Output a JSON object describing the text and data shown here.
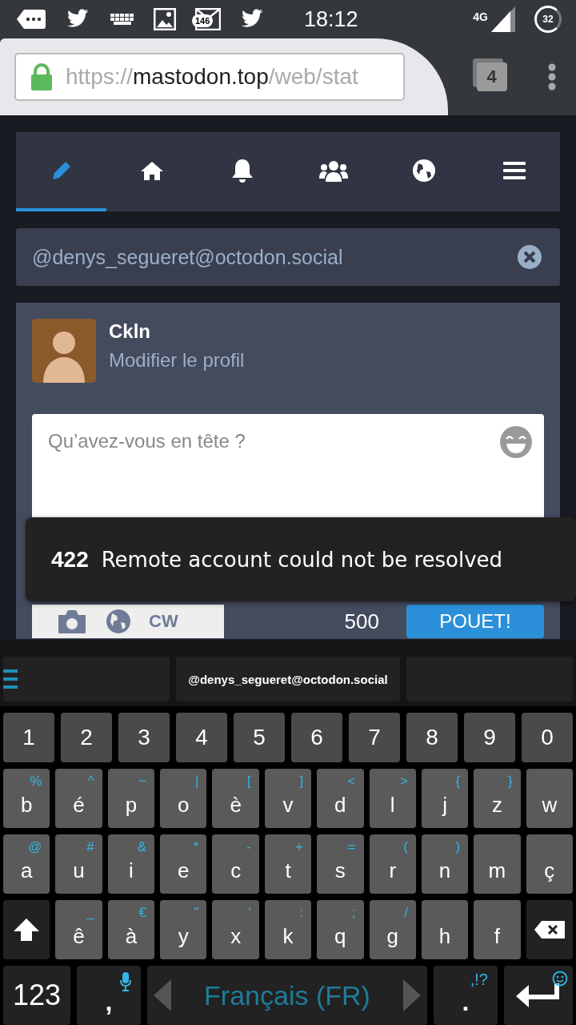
{
  "status_bar": {
    "notification_badge": "146",
    "time": "18:12",
    "network": "4G",
    "battery": "32"
  },
  "browser": {
    "url_scheme": "https://",
    "url_host": "mastodon.top",
    "url_path": "/web/stat",
    "tab_count": "4"
  },
  "nav_tabs": [
    {
      "kind": "compose",
      "selected": true
    },
    {
      "kind": "home",
      "selected": false
    },
    {
      "kind": "notifications",
      "selected": false
    },
    {
      "kind": "community",
      "selected": false
    },
    {
      "kind": "public",
      "selected": false
    },
    {
      "kind": "menu",
      "selected": false
    }
  ],
  "search": {
    "value": "@denys_segueret@octodon.social"
  },
  "profile": {
    "name": "Ckln",
    "edit_link": "Modifier le profil"
  },
  "compose": {
    "placeholder": "Qu’avez-vous en tête ?",
    "cw": "CW",
    "counter": "500",
    "submit": "POUET!"
  },
  "toast": {
    "code": "422",
    "message": "Remote account could not be resolved"
  },
  "keyboard": {
    "suggestion": "@denys_segueret@octodon.social",
    "number_row": [
      "1",
      "2",
      "3",
      "4",
      "5",
      "6",
      "7",
      "8",
      "9",
      "0"
    ],
    "letter_rows": [
      [
        {
          "main": "b",
          "alt": "%"
        },
        {
          "main": "é",
          "alt": "^"
        },
        {
          "main": "p",
          "alt": "~"
        },
        {
          "main": "o",
          "alt": "|"
        },
        {
          "main": "è",
          "alt": "["
        },
        {
          "main": "v",
          "alt": "]"
        },
        {
          "main": "d",
          "alt": "<"
        },
        {
          "main": "l",
          "alt": ">"
        },
        {
          "main": "j",
          "alt": "{"
        },
        {
          "main": "z",
          "alt": "}"
        },
        {
          "main": "w"
        }
      ],
      [
        {
          "main": "a",
          "alt": "@"
        },
        {
          "main": "u",
          "alt": "#"
        },
        {
          "main": "i",
          "alt": "&"
        },
        {
          "main": "e",
          "alt": "*"
        },
        {
          "main": "c",
          "alt": "-"
        },
        {
          "main": "t",
          "alt": "+"
        },
        {
          "main": "s",
          "alt": "="
        },
        {
          "main": "r",
          "alt": "("
        },
        {
          "main": "n",
          "alt": ")"
        },
        {
          "main": "m"
        },
        {
          "main": "ç"
        }
      ],
      [
        {
          "main": "ê",
          "alt": "_"
        },
        {
          "main": "à",
          "alt": "€"
        },
        {
          "main": "y",
          "alt": "\""
        },
        {
          "main": "x",
          "alt": "'"
        },
        {
          "main": "k",
          "alt": ":"
        },
        {
          "main": "q",
          "alt": ";"
        },
        {
          "main": "g",
          "alt": "/"
        },
        {
          "main": "h"
        },
        {
          "main": "f"
        }
      ]
    ],
    "symbols_key": "123",
    "comma_key": ",",
    "language": "Français (FR)",
    "period_key": ".",
    "punctuation_hint": ",!?"
  }
}
